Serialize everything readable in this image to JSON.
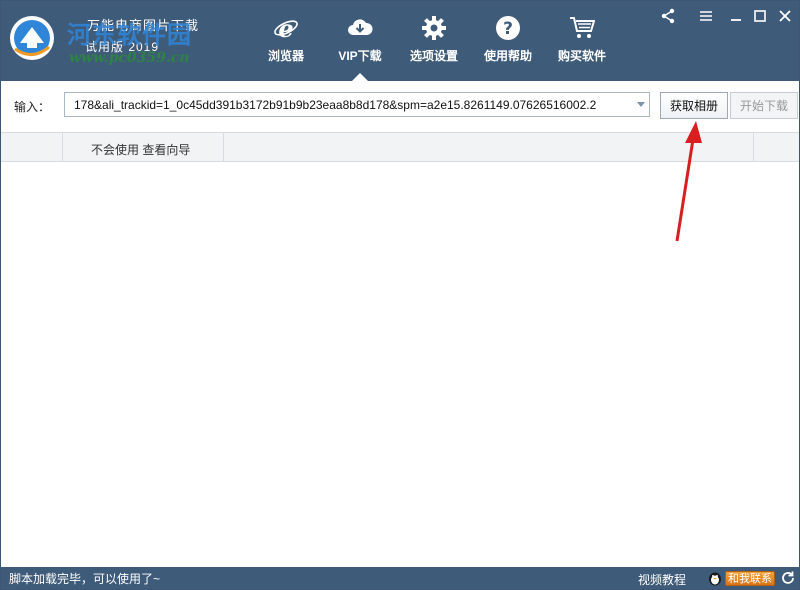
{
  "app": {
    "name": "万能电商图片下载",
    "version": "试用版   2019",
    "watermark": "河东软件园",
    "watermark_url": "www.pc0359.cn"
  },
  "nav": {
    "items": [
      {
        "label": "浏览器",
        "icon": "ie-browser-icon"
      },
      {
        "label": "VIP下载",
        "icon": "cloud-download-icon",
        "active": true
      },
      {
        "label": "选项设置",
        "icon": "gear-icon"
      },
      {
        "label": "使用帮助",
        "icon": "help-icon"
      },
      {
        "label": "购买软件",
        "icon": "cart-icon"
      }
    ]
  },
  "window_controls": [
    "share-icon",
    "menu-icon",
    "minimize-icon",
    "maximize-icon",
    "close-icon"
  ],
  "input": {
    "label": "输入：",
    "value": "178&ali_trackid=1_0c45dd391b3172b91b9b23eaa8b8d178&spm=a2e15.8261149.07626516002.2"
  },
  "buttons": {
    "fetch": "获取相册",
    "start": "开始下载"
  },
  "table": {
    "hint": "不会使用 查看向导"
  },
  "status": {
    "message": "脚本加载完毕，可以使用了~",
    "video_tutorial": "视频教程",
    "contact": "和我联系"
  },
  "colors": {
    "toolbar_bg": "#3f5b7a",
    "annotation_arrow": "#d81e1e"
  }
}
